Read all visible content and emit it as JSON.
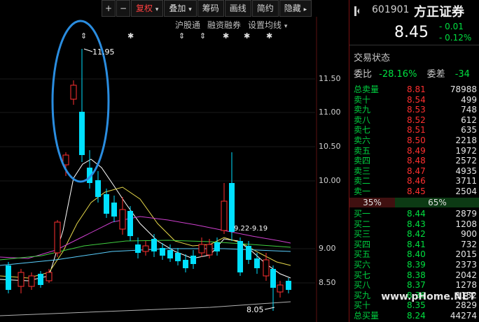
{
  "toolbar": {
    "plus": "+",
    "minus": "−",
    "restore": "复权",
    "restore_arrow": "▾",
    "overlay": "叠加",
    "overlay_arrow": "▾",
    "chips": "筹码",
    "draw": "画线",
    "brief": "简约",
    "hide": "隐藏",
    "hide_arrow": "▸"
  },
  "sub_toolbar": {
    "hk_connect": "沪股通",
    "margin": "融资融券",
    "settings": "设置均线",
    "settings_arrow": "▾"
  },
  "annotations": {
    "high": "11.95",
    "low": "8.05",
    "range": "9.22-9.19"
  },
  "price_axis": [
    "11.50",
    "11.00",
    "10.50",
    "10.00",
    "9.00",
    "8.50"
  ],
  "quote": {
    "code": "601901",
    "name": "方正证券",
    "price": "8.45",
    "change": "- 0.01",
    "change_pct": "- 0.12%",
    "trade_status_label": "交易状态",
    "wb_label": "委比",
    "wb_value": "-28.16%",
    "wc_label": "委差",
    "wc_value": "-34",
    "ratio_buy": "35%",
    "ratio_sell": "65%",
    "ratio_buy_fraction": 0.35
  },
  "sell_book": [
    {
      "label": "总卖量",
      "price": "8.81",
      "vol": "78988"
    },
    {
      "label": "卖十",
      "price": "8.54",
      "vol": "499"
    },
    {
      "label": "卖九",
      "price": "8.53",
      "vol": "748"
    },
    {
      "label": "卖八",
      "price": "8.52",
      "vol": "612"
    },
    {
      "label": "卖七",
      "price": "8.51",
      "vol": "635"
    },
    {
      "label": "卖六",
      "price": "8.50",
      "vol": "2218"
    },
    {
      "label": "卖五",
      "price": "8.49",
      "vol": "1972"
    },
    {
      "label": "卖四",
      "price": "8.48",
      "vol": "2572"
    },
    {
      "label": "卖三",
      "price": "8.47",
      "vol": "4935"
    },
    {
      "label": "卖二",
      "price": "8.46",
      "vol": "3711"
    },
    {
      "label": "卖一",
      "price": "8.45",
      "vol": "2504"
    }
  ],
  "buy_book": [
    {
      "label": "买一",
      "price": "8.44",
      "vol": "2879"
    },
    {
      "label": "买二",
      "price": "8.43",
      "vol": "1208"
    },
    {
      "label": "买三",
      "price": "8.42",
      "vol": "900"
    },
    {
      "label": "买四",
      "price": "8.41",
      "vol": "732"
    },
    {
      "label": "买五",
      "price": "8.40",
      "vol": "2015"
    },
    {
      "label": "买六",
      "price": "8.39",
      "vol": "2373"
    },
    {
      "label": "买七",
      "price": "8.38",
      "vol": "2042"
    },
    {
      "label": "买八",
      "price": "8.37",
      "vol": "1278"
    },
    {
      "label": "买九",
      "price": "8.36",
      "vol": "1152"
    },
    {
      "label": "买十",
      "price": "8.35",
      "vol": "2829"
    },
    {
      "label": "总买量",
      "price": "8.24",
      "vol": "44274"
    }
  ],
  "watermark": "www.pHome.NET",
  "colors": {
    "up": "#ff3030",
    "down": "#00e0ff",
    "ma5": "#ffffff",
    "ma10": "#e6d84a",
    "ma20": "#d040d0",
    "ma60": "#40d040",
    "highlight": "#2a8de0"
  }
}
